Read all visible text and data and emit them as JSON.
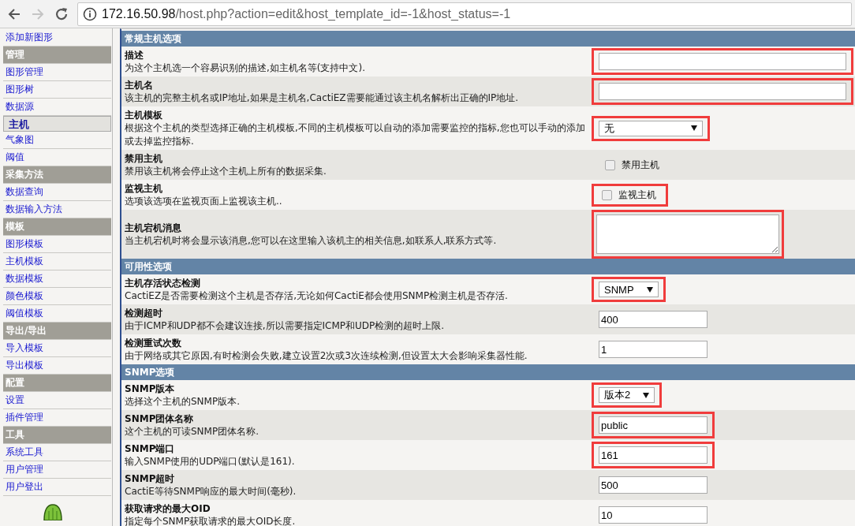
{
  "browser": {
    "back_enabled": true,
    "forward_enabled": false,
    "url_host": "172.16.50.98",
    "url_path": "/host.php?action=edit&host_template_id=-1&host_status=-1"
  },
  "sidebar": {
    "items": [
      {
        "kind": "link",
        "label": "添加新图形",
        "selected": false
      },
      {
        "kind": "header",
        "label": "管理"
      },
      {
        "kind": "link",
        "label": "图形管理",
        "selected": false
      },
      {
        "kind": "link",
        "label": "图形树",
        "selected": false
      },
      {
        "kind": "link",
        "label": "数据源",
        "selected": false
      },
      {
        "kind": "link",
        "label": "主机",
        "selected": true
      },
      {
        "kind": "link",
        "label": "气象图",
        "selected": false
      },
      {
        "kind": "link",
        "label": "阈值",
        "selected": false
      },
      {
        "kind": "header",
        "label": "采集方法"
      },
      {
        "kind": "link",
        "label": "数据查询",
        "selected": false
      },
      {
        "kind": "link",
        "label": "数据输入方法",
        "selected": false
      },
      {
        "kind": "header",
        "label": "模板"
      },
      {
        "kind": "link",
        "label": "图形模板",
        "selected": false
      },
      {
        "kind": "link",
        "label": "主机模板",
        "selected": false
      },
      {
        "kind": "link",
        "label": "数据模板",
        "selected": false
      },
      {
        "kind": "link",
        "label": "颜色模板",
        "selected": false
      },
      {
        "kind": "link",
        "label": "阈值模板",
        "selected": false
      },
      {
        "kind": "header",
        "label": "导出/导出"
      },
      {
        "kind": "link",
        "label": "导入模板",
        "selected": false
      },
      {
        "kind": "link",
        "label": "导出模板",
        "selected": false
      },
      {
        "kind": "header",
        "label": "配置"
      },
      {
        "kind": "link",
        "label": "设置",
        "selected": false
      },
      {
        "kind": "link",
        "label": "插件管理",
        "selected": false
      },
      {
        "kind": "header",
        "label": "工具"
      },
      {
        "kind": "link",
        "label": "系统工具",
        "selected": false
      },
      {
        "kind": "link",
        "label": "用户管理",
        "selected": false
      },
      {
        "kind": "link",
        "label": "用户登出",
        "selected": false
      }
    ]
  },
  "form": {
    "sections": [
      {
        "title": "常规主机选项",
        "rows": [
          {
            "label": "描述",
            "description": "为这个主机选一个容易识别的描述,如主机名等(支持中文).",
            "control": {
              "kind": "wide_text",
              "highlighted": true
            }
          },
          {
            "label": "主机名",
            "description": "该主机的完整主机名或IP地址,如果是主机名,CactiEZ需要能通过该主机名解析出正确的IP地址.",
            "control": {
              "kind": "wide_text",
              "highlighted": true
            }
          },
          {
            "label": "主机模板",
            "description": "根据这个主机的类型选择正确的主机模板,不同的主机模板可以自动的添加需要监控的指标,您也可以手动的添加或去掉监控指标.",
            "control": {
              "kind": "wide_select",
              "value": "无",
              "highlighted": true
            }
          },
          {
            "label": "禁用主机",
            "description": "禁用该主机将会停止这个主机上所有的数据采集.",
            "control": {
              "kind": "checkbox",
              "label": "禁用主机",
              "checked": false,
              "highlighted": false
            }
          },
          {
            "label": "监视主机",
            "description": "选项该选项在监视页面上监视该主机..",
            "control": {
              "kind": "checkbox",
              "label": "监视主机",
              "checked": false,
              "highlighted": true
            }
          },
          {
            "label": "主机宕机消息",
            "description": "当主机宕机时将会显示该消息,您可以在这里输入该机主的相关信息,如联系人,联系方式等.",
            "control": {
              "kind": "textarea",
              "highlighted": true
            }
          }
        ]
      },
      {
        "title": "可用性选项",
        "rows": [
          {
            "label": "主机存活状态检测",
            "description": "CactiEZ是否需要检测这个主机是否存活,无论如何CactiE都会使用SNMP检测主机是否存活.",
            "control": {
              "kind": "select",
              "value": "SNMP",
              "highlighted": true
            }
          },
          {
            "label": "检测超时",
            "description": "由于ICMP和UDP都不会建议连接,所以需要指定ICMP和UDP检测的超时上限.",
            "control": {
              "kind": "text",
              "value": "400",
              "highlighted": false
            }
          },
          {
            "label": "检测重试次数",
            "description": "由于网络或其它原因,有时检测会失败,建立设置2次或3次连续检测,但设置太大会影响采集器性能.",
            "control": {
              "kind": "text",
              "value": "1",
              "highlighted": false
            }
          }
        ]
      },
      {
        "title": "SNMP选项",
        "rows": [
          {
            "label": "SNMP版本",
            "description": "选择这个主机的SNMP版本.",
            "control": {
              "kind": "select",
              "value": "版本2",
              "highlighted": true
            }
          },
          {
            "label": "SNMP团体名称",
            "description": "这个主机的可读SNMP团体名称.",
            "control": {
              "kind": "text",
              "value": "public",
              "highlighted": true
            }
          },
          {
            "label": "SNMP端口",
            "description": "输入SNMP使用的UDP端口(默认是161).",
            "control": {
              "kind": "text",
              "value": "161",
              "highlighted": true
            }
          },
          {
            "label": "SNMP超时",
            "description": "CactiE等待SNMP响应的最大时间(毫秒).",
            "control": {
              "kind": "text",
              "value": "500",
              "highlighted": false
            }
          },
          {
            "label": "获取请求的最大OID",
            "description": "指定每个SNMP获取请求的最大OID长度.",
            "control": {
              "kind": "text",
              "value": "10",
              "highlighted": false
            }
          }
        ]
      }
    ]
  }
}
